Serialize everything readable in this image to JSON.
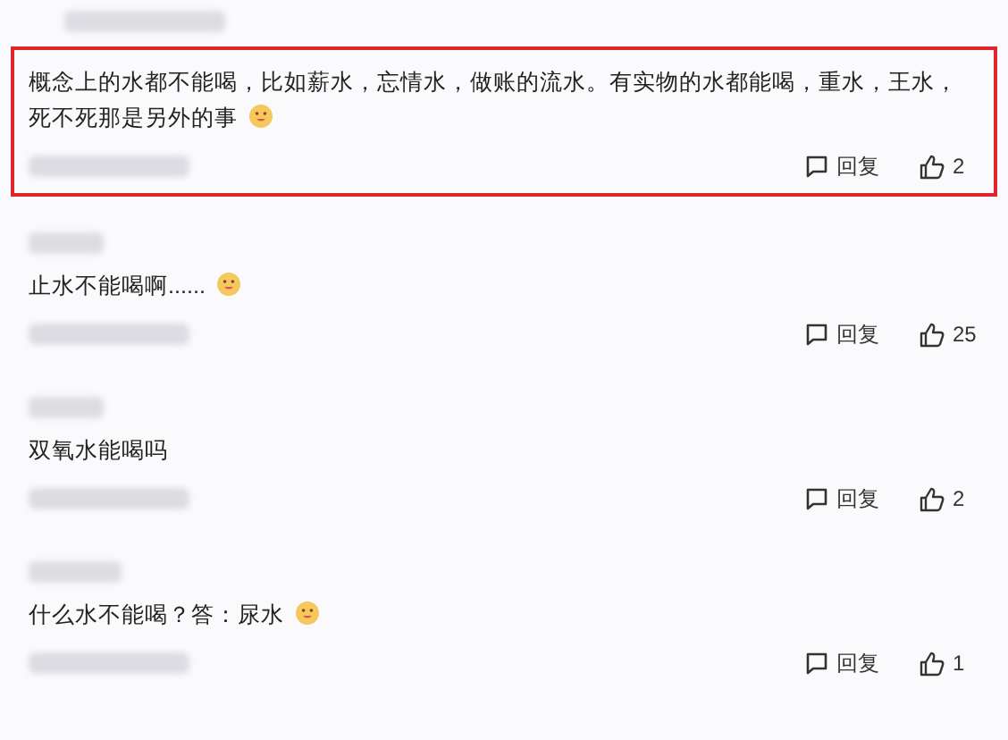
{
  "comments": [
    {
      "text": "概念上的水都不能喝，比如薪水，忘情水，做账的流水。有实物的水都能喝，重水，王水，死不死那是另外的事",
      "has_emoji": true,
      "highlighted": true,
      "reply": "回复",
      "likes": "2"
    },
    {
      "text": "止水不能喝啊......",
      "has_emoji": true,
      "highlighted": false,
      "reply": "回复",
      "likes": "25"
    },
    {
      "text": "双氧水能喝吗",
      "has_emoji": false,
      "highlighted": false,
      "reply": "回复",
      "likes": "2"
    },
    {
      "text": "什么水不能喝？答：尿水",
      "has_emoji": true,
      "highlighted": false,
      "reply": "回复",
      "likes": "1"
    }
  ]
}
